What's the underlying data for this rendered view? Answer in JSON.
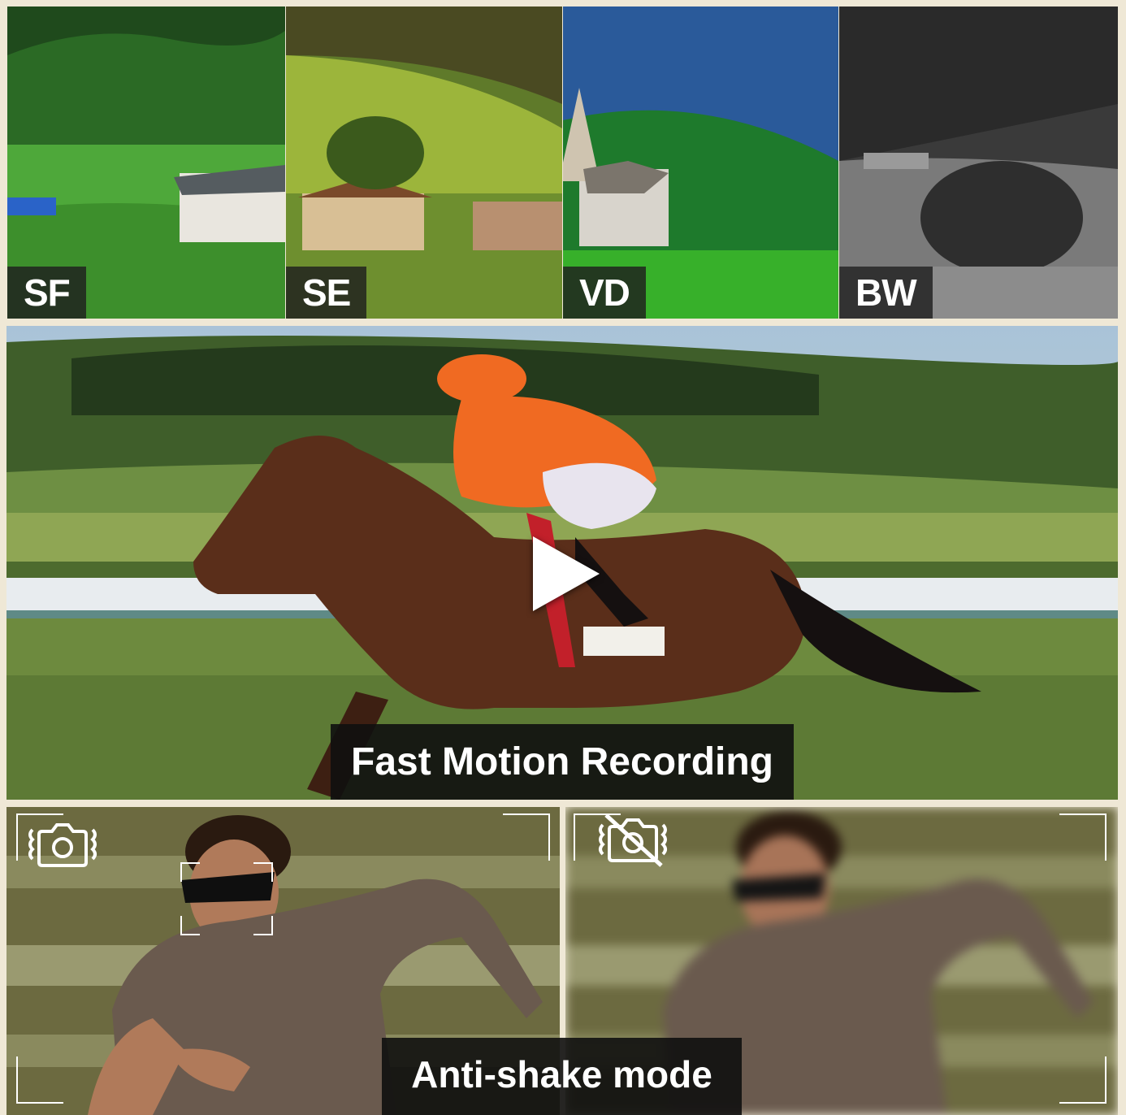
{
  "filters": {
    "tiles": [
      {
        "label": "SF"
      },
      {
        "label": "SE"
      },
      {
        "label": "VD"
      },
      {
        "label": "BW"
      }
    ]
  },
  "fast_motion": {
    "caption": "Fast Motion Recording",
    "play_icon": "play-icon"
  },
  "anti_shake": {
    "caption": "Anti-shake mode",
    "left_icon": "camera-stabilized-icon",
    "right_icon": "camera-off-icon"
  },
  "colors": {
    "background": "#efe8d6",
    "caption_bg": "#0f0f0f",
    "jockey_orange": "#f06a22"
  }
}
